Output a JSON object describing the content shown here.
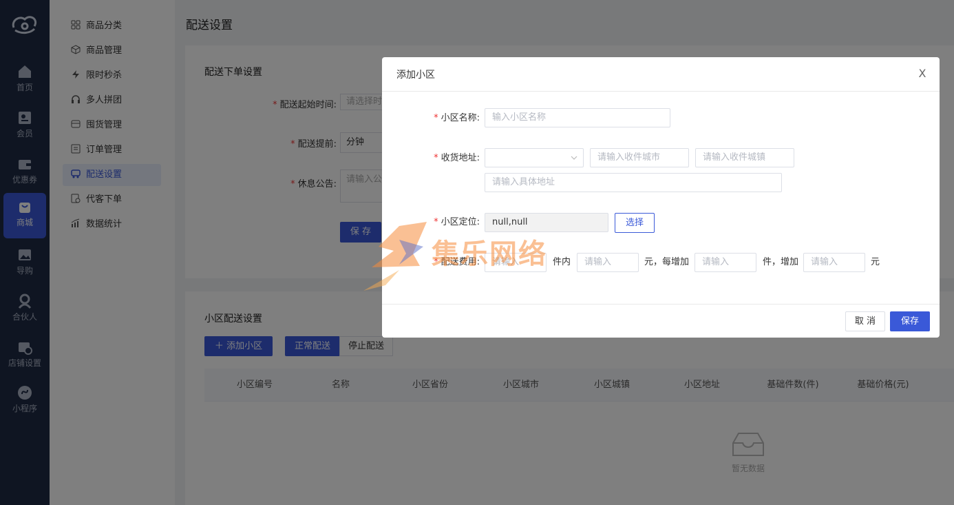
{
  "rail": {
    "items": [
      {
        "label": "首页",
        "icon": "home-icon"
      },
      {
        "label": "会员",
        "icon": "member-card-icon"
      },
      {
        "label": "优惠券",
        "icon": "wallet-icon"
      },
      {
        "label": "商城",
        "icon": "shopping-bag-icon",
        "active": true
      },
      {
        "label": "导购",
        "icon": "image-icon"
      },
      {
        "label": "合伙人",
        "icon": "partner-icon"
      },
      {
        "label": "店铺设置",
        "icon": "store-settings-icon"
      },
      {
        "label": "小程序",
        "icon": "mini-program-icon"
      }
    ]
  },
  "subnav": {
    "items": [
      {
        "label": "商品分类",
        "icon": "grid-icon"
      },
      {
        "label": "商品管理",
        "icon": "cube-icon"
      },
      {
        "label": "限时秒杀",
        "icon": "lightning-icon"
      },
      {
        "label": "多人拼团",
        "icon": "headset-icon"
      },
      {
        "label": "囤货管理",
        "icon": "storage-icon"
      },
      {
        "label": "订单管理",
        "icon": "list-icon"
      },
      {
        "label": "配送设置",
        "icon": "truck-icon",
        "active": true
      },
      {
        "label": "代客下单",
        "icon": "receipt-icon"
      },
      {
        "label": "数据统计",
        "icon": "chart-icon"
      }
    ]
  },
  "page": {
    "title": "配送设置",
    "order_card": {
      "title": "配送下单设置",
      "start_time_label": "配送起始时间:",
      "start_time_placeholder": "请选择时间",
      "advance_label": "配送提前:",
      "advance_unit": "分钟",
      "notice_label": "休息公告:",
      "notice_placeholder": "请输入公",
      "save_label": "保 存"
    },
    "community_card": {
      "title": "小区配送设置",
      "add_button": "添加小区",
      "tab_normal": "正常配送",
      "tab_stop": "停止配送",
      "columns": [
        "小区编号",
        "名称",
        "小区省份",
        "小区城市",
        "小区城镇",
        "小区地址",
        "基础件数(件)",
        "基础价格(元)"
      ],
      "empty_text": "暂无数据"
    }
  },
  "modal": {
    "title": "添加小区",
    "close_label": "X",
    "name_label": "小区名称:",
    "name_placeholder": "输入小区名称",
    "address_label": "收货地址:",
    "province_value": "",
    "city_placeholder": "请输入收件城市",
    "town_placeholder": "请输入收件城镇",
    "detail_placeholder": "请输入具体地址",
    "location_label": "小区定位:",
    "location_value": "null,null",
    "choose_label": "选择",
    "fee_label": "配送费用:",
    "fee_base_qty_placeholder": "请输入",
    "fee_text_1": "件内",
    "fee_base_price_placeholder": "请输入",
    "fee_text_2": "元，每增加",
    "fee_add_qty_placeholder": "请输入",
    "fee_text_3": "件，增加",
    "fee_add_price_placeholder": "请输入",
    "fee_text_4": "元",
    "cancel_label": "取 消",
    "save_label": "保存"
  },
  "watermark": {
    "text": "集乐网络"
  },
  "colors": {
    "primary": "#3a59d8",
    "rail_bg": "#1f2a44",
    "required": "#e33333"
  }
}
